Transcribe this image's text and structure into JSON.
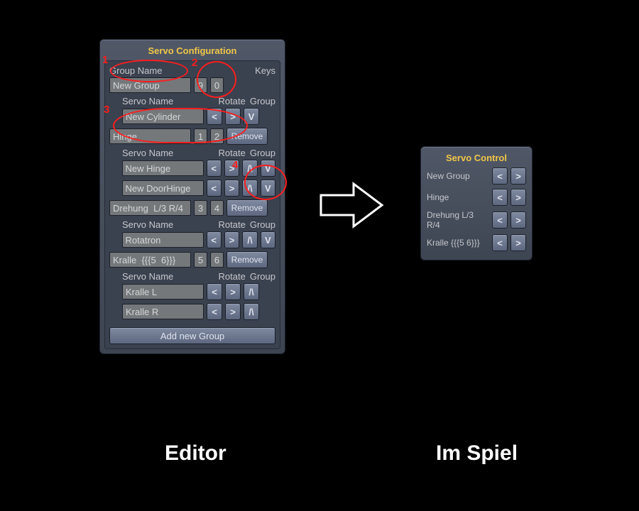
{
  "editor": {
    "title": "Servo Configuration",
    "group_hdr": "Group Name",
    "keys_hdr": "Keys",
    "servo_hdr": "Servo Name",
    "rotate_hdr": "Rotate",
    "groupcol_hdr": "Group",
    "remove_label": "Remove",
    "addgroup_label": "Add new Group",
    "lt": "<",
    "gt": ">",
    "up": "/\\",
    "dn": "V",
    "groups": [
      {
        "name": "New Group",
        "keyL": "9",
        "keyR": "0",
        "servos": [
          {
            "name": "New Cylinder",
            "has_up": false,
            "has_dn": true
          }
        ]
      },
      {
        "name": "Hinge",
        "keyL": "1",
        "keyR": "2",
        "servos": [
          {
            "name": "New Hinge",
            "has_up": true,
            "has_dn": true
          },
          {
            "name": "New DoorHinge",
            "has_up": true,
            "has_dn": true
          }
        ]
      },
      {
        "name": "Drehung  L/3 R/4",
        "keyL": "3",
        "keyR": "4",
        "servos": [
          {
            "name": "Rotatron",
            "has_up": true,
            "has_dn": true
          }
        ]
      },
      {
        "name": "Kralle  {{{5  6}}}",
        "keyL": "5",
        "keyR": "6",
        "servos": [
          {
            "name": "Kralle L",
            "has_up": true,
            "has_dn": false
          },
          {
            "name": "Kralle R",
            "has_up": true,
            "has_dn": false
          }
        ]
      }
    ]
  },
  "control": {
    "title": "Servo Control",
    "lt": "<",
    "gt": ">",
    "rows": [
      {
        "label": "New Group"
      },
      {
        "label": "Hinge"
      },
      {
        "label": "Drehung L/3 R/4"
      },
      {
        "label": "Kralle {{{5  6}}}"
      }
    ]
  },
  "captions": {
    "editor": "Editor",
    "spiel": "Im Spiel"
  },
  "annotations": {
    "n1": "1",
    "n2": "2",
    "n3": "3",
    "n4": "4"
  }
}
